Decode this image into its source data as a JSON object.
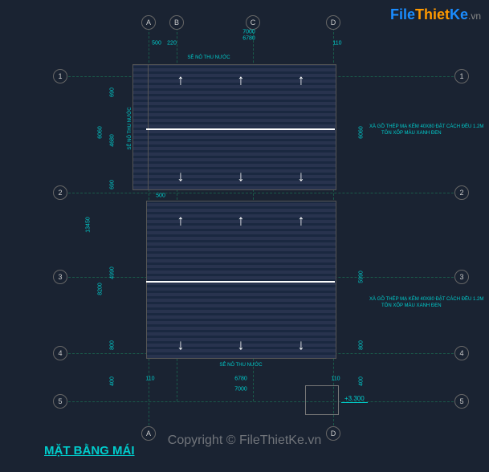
{
  "logo": {
    "file": "File",
    "thiet": "Thiet",
    "ke": "Ke",
    "vn": ".vn"
  },
  "title": "MẶT BẰNG MÁI",
  "copyright": "Copyright © FileThietKe.vn",
  "grid_letters": [
    "A",
    "B",
    "C",
    "D"
  ],
  "grid_numbers": [
    "1",
    "2",
    "3",
    "4",
    "5"
  ],
  "dims_top": {
    "d1": "500",
    "d2": "220",
    "d3": "6780",
    "d4": "110",
    "total": "7000"
  },
  "dims_left": {
    "d1": "690",
    "d2": "4680",
    "d3": "690",
    "d4": "4990",
    "d5": "800",
    "d6": "400",
    "seg1": "6060",
    "seg2": "8200",
    "total": "13450"
  },
  "dims_right": {
    "d1": "6060",
    "d2": "5990",
    "d3": "800",
    "d4": "400"
  },
  "dims_bot": {
    "d1": "110",
    "d2": "6780",
    "d3": "110"
  },
  "notes": {
    "note1_l1": "XÀ GỒ THÉP MẠ KẼM 40X80 ĐẶT CÁCH ĐỀU 1.2M",
    "note1_l2": "TÔN XỐP MÀU XANH ĐEN",
    "note2_l1": "XÀ GỒ THÉP MẠ KẼM 40X80 ĐẶT CÁCH ĐỀU 1.2M",
    "note2_l2": "TÔN XỐP MÀU XANH ĐEN"
  },
  "gutter": {
    "g1": "SÊ NÔ THU NƯỚC",
    "g2": "SÊ NÔ THU NƯỚC",
    "g3": "SÊ NÔ THU NƯỚC"
  },
  "elevation": "+3.300",
  "middim": "500"
}
